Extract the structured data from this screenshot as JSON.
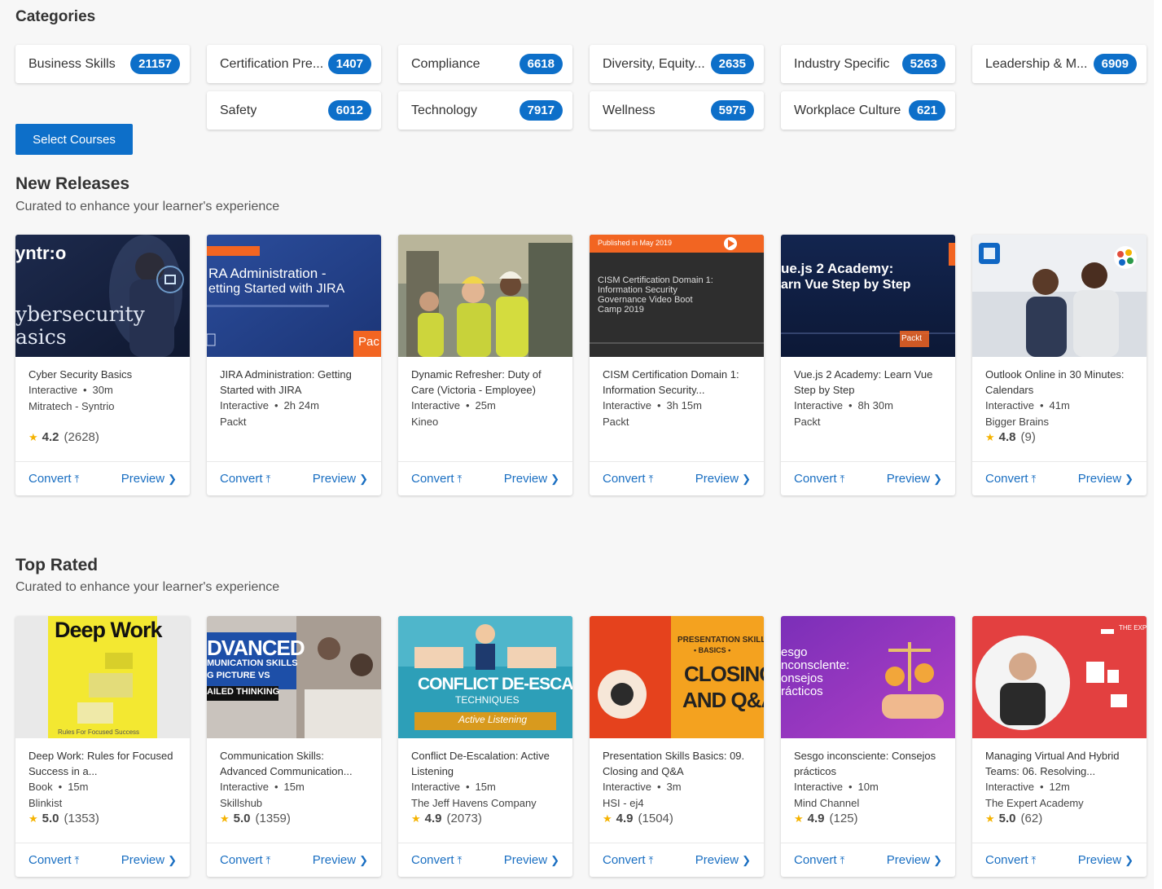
{
  "categories": {
    "title": "Categories",
    "items": [
      {
        "label": "Business Skills",
        "count": "21157"
      },
      {
        "label": "Certification Pre...",
        "count": "1407"
      },
      {
        "label": "Compliance",
        "count": "6618"
      },
      {
        "label": "Diversity, Equity...",
        "count": "2635"
      },
      {
        "label": "Industry Specific",
        "count": "5263"
      },
      {
        "label": "Leadership & M...",
        "count": "6909"
      },
      {
        "label": "Safety",
        "count": "6012"
      },
      {
        "label": "Technology",
        "count": "7917"
      },
      {
        "label": "Wellness",
        "count": "5975"
      },
      {
        "label": "Workplace Culture",
        "count": "621"
      }
    ],
    "select_button": "Select Courses"
  },
  "new_releases": {
    "title": "New Releases",
    "subtitle": "Curated to enhance your learner's experience",
    "cards": [
      {
        "title": "Cyber Security Basics",
        "type": "Interactive",
        "duration": "30m",
        "provider": "Mitratech - Syntrio",
        "rating": "4.2",
        "reviews": "(2628)",
        "thumb": {
          "line1": "yntr:o",
          "line2": "ybersecurity",
          "line3": "asics"
        }
      },
      {
        "title": "JIRA Administration: Getting Started with JIRA",
        "type": "Interactive",
        "duration": "2h 24m",
        "provider": "Packt",
        "thumb": {
          "line1": "RA Administration -",
          "line2": "etting Started with JIRA",
          "badge": "Pac"
        }
      },
      {
        "title": "Dynamic Refresher: Duty of Care (Victoria - Employee)",
        "type": "Interactive",
        "duration": "25m",
        "provider": "Kineo"
      },
      {
        "title": "CISM Certification Domain 1: Information Security...",
        "type": "Interactive",
        "duration": "3h 15m",
        "provider": "Packt",
        "thumb": {
          "banner": "Published in May 2019",
          "l1": "CISM Certification Domain 1:",
          "l2": "Information Security",
          "l3": "Governance Video Boot",
          "l4": "Camp 2019"
        }
      },
      {
        "title": "Vue.js 2 Academy: Learn Vue Step by Step",
        "type": "Interactive",
        "duration": "8h 30m",
        "provider": "Packt",
        "thumb": {
          "line1": "ue.js 2 Academy:",
          "line2": "arn Vue Step by Step",
          "badge": "Packt"
        }
      },
      {
        "title": "Outlook Online in 30 Minutes: Calendars",
        "type": "Interactive",
        "duration": "41m",
        "provider": "Bigger Brains",
        "rating": "4.8",
        "reviews": "(9)"
      }
    ]
  },
  "top_rated": {
    "title": "Top Rated",
    "subtitle": "Curated to enhance your learner's experience",
    "cards": [
      {
        "title": "Deep Work: Rules for Focused Success in a...",
        "type": "Book",
        "duration": "15m",
        "provider": "Blinkist",
        "rating": "5.0",
        "reviews": "(1353)",
        "thumb": {
          "line1": "Deep Work",
          "line2": "Rules For Focused Success"
        }
      },
      {
        "title": "Communication Skills: Advanced Communication...",
        "type": "Interactive",
        "duration": "15m",
        "provider": "Skillshub",
        "rating": "5.0",
        "reviews": "(1359)",
        "thumb": {
          "line1": "DVANCED",
          "line2": "MUNICATION SKILLS",
          "line3": "G PICTURE VS",
          "line4": "AILED THINKING"
        }
      },
      {
        "title": "Conflict De-Escalation: Active Listening",
        "type": "Interactive",
        "duration": "15m",
        "provider": "The Jeff Havens Company",
        "rating": "4.9",
        "reviews": "(2073)",
        "thumb": {
          "line1": "CONFLICT DE-ESCALATION",
          "line2": "TECHNIQUES",
          "line3": "Active Listening"
        }
      },
      {
        "title": "Presentation Skills Basics: 09. Closing and Q&A",
        "type": "Interactive",
        "duration": "3m",
        "provider": "HSI - ej4",
        "rating": "4.9",
        "reviews": "(1504)",
        "thumb": {
          "line1": "PRESENTATION SKILLS",
          "line2": "• BASICS •",
          "line3": "CLOSING",
          "line4": "AND Q&A"
        }
      },
      {
        "title": "Sesgo inconsciente: Consejos prácticos",
        "type": "Interactive",
        "duration": "10m",
        "provider": "Mind Channel",
        "rating": "4.9",
        "reviews": "(125)",
        "thumb": {
          "line1": "esgo",
          "line2": "nconsclente:",
          "line3": "onsejos",
          "line4": "rácticos"
        }
      },
      {
        "title": "Managing Virtual And Hybrid Teams: 06. Resolving...",
        "type": "Interactive",
        "duration": "12m",
        "provider": "The Expert Academy",
        "rating": "5.0",
        "reviews": "(62)",
        "thumb": {
          "line1": "THE EXP"
        }
      }
    ]
  },
  "actions": {
    "convert": "Convert",
    "preview": "Preview"
  },
  "colors": {
    "accent": "#0d6fc9",
    "link": "#1a6fc2",
    "star": "#f5b301"
  }
}
